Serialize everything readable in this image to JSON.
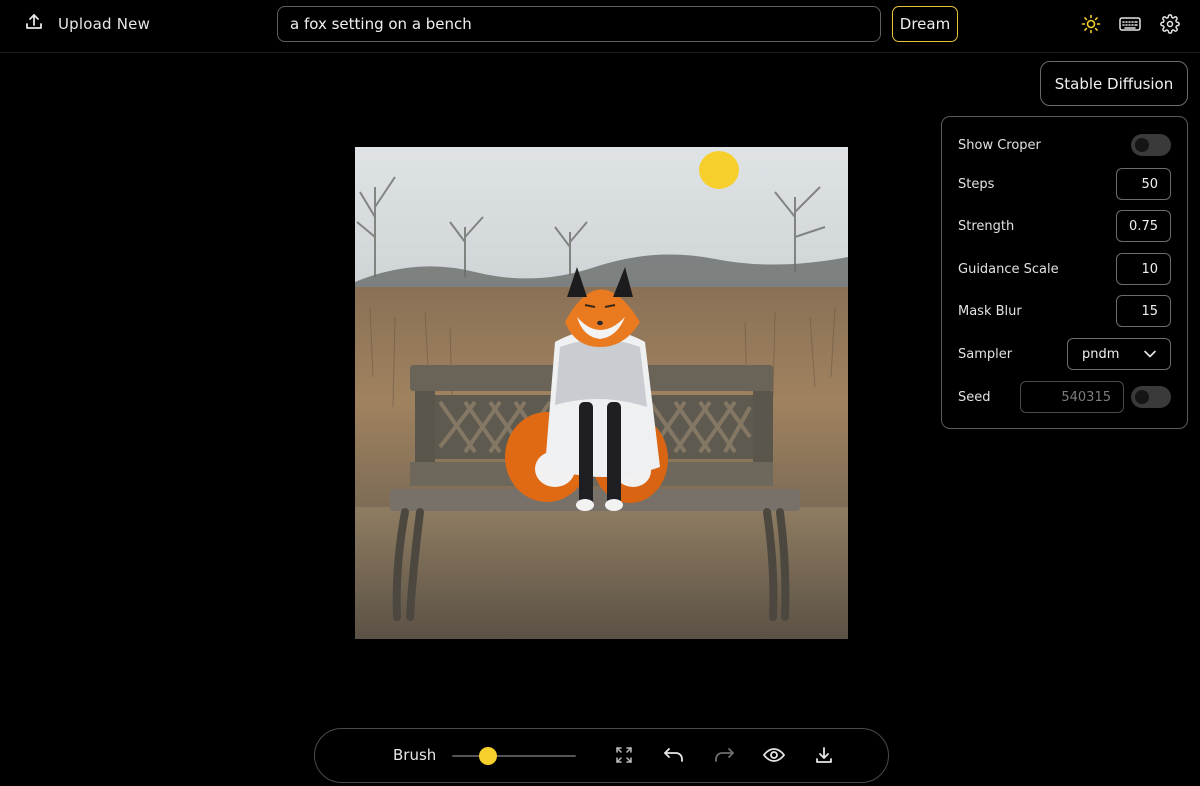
{
  "header": {
    "upload_label": "Upload New",
    "prompt_value": "a fox setting on a bench",
    "dream_label": "Dream",
    "icons": [
      "upload-icon",
      "sun-icon",
      "keyboard-icon",
      "gear-icon"
    ]
  },
  "model_button": {
    "label": "Stable Diffusion"
  },
  "settings": {
    "show_cropper": {
      "label": "Show Croper",
      "enabled": false
    },
    "steps": {
      "label": "Steps",
      "value": "50"
    },
    "strength": {
      "label": "Strength",
      "value": "0.75"
    },
    "guidance_scale": {
      "label": "Guidance Scale",
      "value": "10"
    },
    "mask_blur": {
      "label": "Mask Blur",
      "value": "15"
    },
    "sampler": {
      "label": "Sampler",
      "value": "pndm"
    },
    "seed": {
      "label": "Seed",
      "placeholder": "540315",
      "enabled": false
    }
  },
  "canvas": {
    "image_description_icon": "image-canvas"
  },
  "toolbar": {
    "brush_label": "Brush",
    "brush_size_fraction": 0.25,
    "icons": [
      "fullscreen-icon",
      "undo-icon",
      "redo-icon",
      "eye-icon",
      "download-icon"
    ]
  },
  "colors": {
    "accent": "#f6cf2d",
    "background": "#000000",
    "border": "#5a5a5a"
  }
}
